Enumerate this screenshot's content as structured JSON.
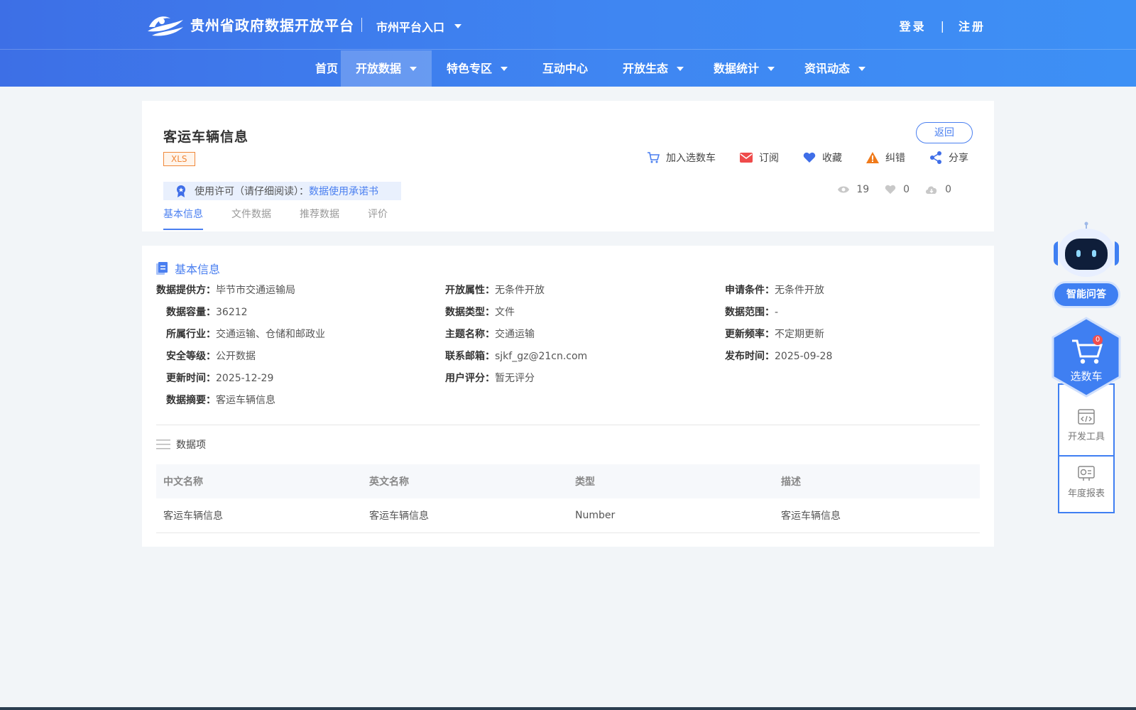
{
  "header": {
    "site_title": "贵州省政府数据开放平台",
    "city_entry": "市州平台入口",
    "login": "登录",
    "separator": "|",
    "register": "注册"
  },
  "nav": {
    "items": [
      {
        "label": "首页",
        "dropdown": false
      },
      {
        "label": "开放数据",
        "dropdown": true,
        "active": true
      },
      {
        "label": "特色专区",
        "dropdown": true
      },
      {
        "label": "互动中心",
        "dropdown": false
      },
      {
        "label": "开放生态",
        "dropdown": true
      },
      {
        "label": "数据统计",
        "dropdown": true
      },
      {
        "label": "资讯动态",
        "dropdown": true
      }
    ]
  },
  "dataset": {
    "title": "客运车辆信息",
    "format": "XLS",
    "back": "返回",
    "actions": {
      "add_cart": "加入选数车",
      "subscribe": "订阅",
      "favorite": "收藏",
      "report_error": "纠错",
      "share": "分享"
    },
    "license_label": "使用许可（请仔细阅读）：",
    "license_link": "数据使用承诺书",
    "stats": {
      "views": "19",
      "likes": "0",
      "downloads": "0"
    },
    "tabs": [
      "基本信息",
      "文件数据",
      "推荐数据",
      "评价"
    ]
  },
  "basic_info": {
    "section_title": "基本信息",
    "rows": [
      [
        {
          "label": "数据提供方：",
          "value": "毕节市交通运输局"
        },
        {
          "label": "开放属性：",
          "value": "无条件开放"
        },
        {
          "label": "申请条件：",
          "value": "无条件开放"
        }
      ],
      [
        {
          "label": "数据容量：",
          "value": "36212"
        },
        {
          "label": "数据类型：",
          "value": "文件"
        },
        {
          "label": "数据范围：",
          "value": "-"
        }
      ],
      [
        {
          "label": "所属行业：",
          "value": "交通运输、仓储和邮政业"
        },
        {
          "label": "主题名称：",
          "value": "交通运输"
        },
        {
          "label": "更新频率：",
          "value": "不定期更新"
        }
      ],
      [
        {
          "label": "安全等级：",
          "value": "公开数据"
        },
        {
          "label": "联系邮箱：",
          "value": "sjkf_gz@21cn.com"
        },
        {
          "label": "发布时间：",
          "value": "2025-09-28"
        }
      ],
      [
        {
          "label": "更新时间：",
          "value": "2025-12-29"
        },
        {
          "label": "用户评分：",
          "value": "暂无评分"
        }
      ],
      [
        {
          "label": "数据摘要：",
          "value": "客运车辆信息"
        }
      ]
    ]
  },
  "data_items": {
    "section_title": "数据项",
    "columns": [
      "中文名称",
      "英文名称",
      "类型",
      "描述"
    ],
    "rows": [
      [
        "客运车辆信息",
        "客运车辆信息",
        "Number",
        "客运车辆信息"
      ]
    ]
  },
  "sidebar": {
    "qa": "智能问答",
    "cart": "选数车",
    "cart_count": "0",
    "dev_tools": "开发工具",
    "annual_report": "年度报表"
  },
  "colors": {
    "primary": "#4a7ff0",
    "header_start": "#3d6fe6",
    "header_end": "#3d90f5",
    "tag_orange": "#f0883a"
  }
}
